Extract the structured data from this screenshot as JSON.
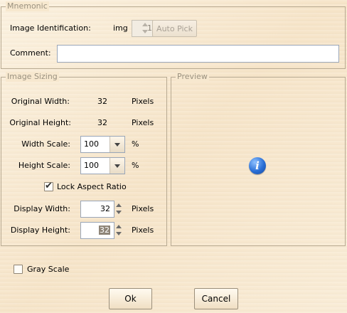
{
  "mnemonic": {
    "legend": "Mnemonic",
    "image_id_label": "Image Identification:",
    "image_id_prefix": "img",
    "image_id_value": "1",
    "auto_pick_label": "Auto Pick",
    "comment_label": "Comment:",
    "comment_value": ""
  },
  "sizing": {
    "legend": "Image Sizing",
    "original_width_label": "Original Width:",
    "original_width_value": "32",
    "original_width_unit": "Pixels",
    "original_height_label": "Original Height:",
    "original_height_value": "32",
    "original_height_unit": "Pixels",
    "width_scale_label": "Width Scale:",
    "width_scale_value": "100",
    "width_scale_unit": "%",
    "height_scale_label": "Height Scale:",
    "height_scale_value": "100",
    "height_scale_unit": "%",
    "lock_aspect_label": "Lock Aspect Ratio",
    "lock_aspect_checked": true,
    "display_width_label": "Display Width:",
    "display_width_value": "32",
    "display_width_unit": "Pixels",
    "display_height_label": "Display Height:",
    "display_height_value": "32",
    "display_height_unit": "Pixels"
  },
  "preview": {
    "legend": "Preview",
    "icon": "info-icon",
    "icon_glyph": "i"
  },
  "gray_scale": {
    "label": "Gray Scale",
    "checked": false
  },
  "buttons": {
    "ok": "Ok",
    "cancel": "Cancel"
  }
}
